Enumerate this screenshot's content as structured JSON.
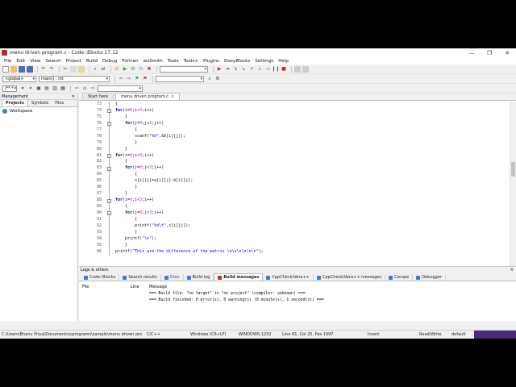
{
  "window": {
    "title": "menu driven program.c - Code::Blocks 17.12",
    "minimize": "—",
    "maximize": "❐",
    "close": "✕"
  },
  "menubar": {
    "items": [
      "File",
      "Edit",
      "View",
      "Search",
      "Project",
      "Build",
      "Debug",
      "Fortran",
      "wxSmith",
      "Tools",
      "Tools+",
      "Plugins",
      "DoxyBlocks",
      "Settings",
      "Help"
    ]
  },
  "toolbar": {
    "scope_combo": "<global>",
    "function_combo": "main() : int",
    "regex_label": "/** *<"
  },
  "management": {
    "title": "Management",
    "tabs": [
      "Projects",
      "Symbols",
      "Files"
    ],
    "workspace": "Workspace"
  },
  "editor": {
    "tabs": [
      {
        "label": "Start here"
      },
      {
        "label": "menu driven program.c"
      }
    ],
    "lines": [
      {
        "n": "73",
        "code": "{"
      },
      {
        "n": "74",
        "code": "for(i=0;i<3;i++)"
      },
      {
        "n": "75",
        "code": "    {"
      },
      {
        "n": "76",
        "code": "    for(j=0;j<3;j++)"
      },
      {
        "n": "77",
        "code": "        {"
      },
      {
        "n": "78",
        "code": "        scanf(\"%d\",&b[i][j]);"
      },
      {
        "n": "79",
        "code": "        }"
      },
      {
        "n": "80",
        "code": "    }"
      },
      {
        "n": "81",
        "code": "for(i=0;i<3;i++)"
      },
      {
        "n": "82",
        "code": "    {"
      },
      {
        "n": "83",
        "code": "    for(j=0;j<3;j++)"
      },
      {
        "n": "84",
        "code": "        {"
      },
      {
        "n": "85",
        "code": "        c[i][j]=a[i][j]-b[i][j];"
      },
      {
        "n": "86",
        "code": "        }"
      },
      {
        "n": "87",
        "code": "    }"
      },
      {
        "n": "88",
        "code": "for(i=0;i<3;i++)"
      },
      {
        "n": "89",
        "code": "    {"
      },
      {
        "n": "90",
        "code": "    for(j=0;j<3;j++)"
      },
      {
        "n": "91",
        "code": "        {"
      },
      {
        "n": "92",
        "code": "        printf(\"%d\\t\",c[i][j]);"
      },
      {
        "n": "93",
        "code": "        }"
      },
      {
        "n": "94",
        "code": "    printf(\"\\n\");"
      },
      {
        "n": "95",
        "code": "    }"
      },
      {
        "n": "96",
        "code": "printf(\"This are the difference of the matrix \\n\\n\\n\\n\\n\\n\");"
      }
    ]
  },
  "logs": {
    "title": "Logs & others",
    "tabs": [
      "Code::Blocks",
      "Search results",
      "Cccc",
      "Build log",
      "Build messages",
      "CppCheck/Vera++",
      "CppCheck/Vera++ messages",
      "Cscope",
      "Debugger"
    ],
    "columns": [
      "File",
      "Line",
      "Message"
    ],
    "rows": [
      "=== Build file: \"no target\" in \"no project\" (compiler: unknown) ===",
      "=== Build finished: 0 error(s), 0 warning(s) (0 minute(s), 1 second(s)) ==="
    ]
  },
  "status": {
    "path": "C:\\Users\\Bhanu Priya\\Documents\\cprograms\\sample\\menu driven pro",
    "language": "C/C++",
    "line_endings": "Windows (CR+LF)",
    "encoding": "WINDOWS-1252",
    "position": "Line 81, Col 25, Pos 1997",
    "mode": "Insert",
    "access": "Read/Write",
    "profile": "default"
  },
  "colors": {
    "keyword": "#00008b",
    "number": "#ff00ff",
    "string": "#0000ff"
  }
}
